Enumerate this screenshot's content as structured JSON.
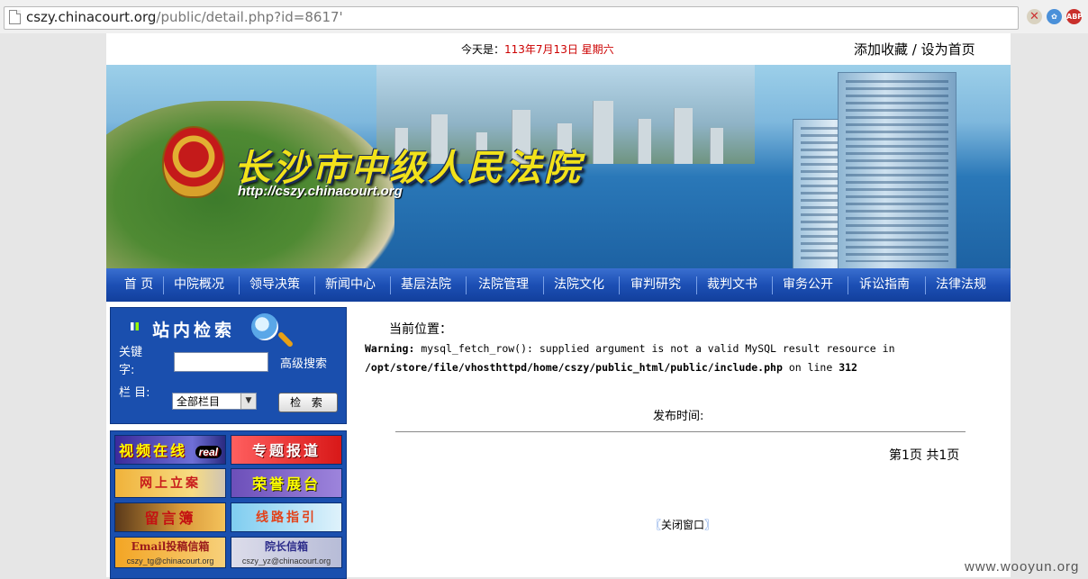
{
  "browser": {
    "url_host": "cszy.chinacourt.org",
    "url_path": "/public/detail.php?id=8617'",
    "extension_icons": [
      "blocker-icon",
      "gear-flower-icon",
      "adblock-icon"
    ],
    "abp_label": "ABP"
  },
  "topbar": {
    "today_label": "今天是：",
    "today_date": "113年7月13日  星期六",
    "favorites": "添加收藏  /  设为首页"
  },
  "banner": {
    "title": "长沙市中级人民法院",
    "url": "http://cszy.chinacourt.org"
  },
  "nav": [
    "首 页",
    "中院概况",
    "领导决策",
    "新闻中心",
    "基层法院",
    "法院管理",
    "法院文化",
    "审判研究",
    "裁判文书",
    "审务公开",
    "诉讼指南",
    "法律法规"
  ],
  "search": {
    "title": "站内检索",
    "keyword_label": "关键字:",
    "advanced": "高级搜索",
    "column_label": "栏  目:",
    "column_value": "全部栏目",
    "button": "检 索"
  },
  "tiles": {
    "video": "视频在线",
    "video_badge": "real",
    "special": "专题报道",
    "online_filing": "网上立案",
    "honor": "荣誉展台",
    "guestbook": "留言簿",
    "route": "线路指引",
    "email_title": "Email投稿信箱",
    "email_addr": "cszy_tg@chinacourt.org",
    "president_title": "院长信箱",
    "president_addr": "cszy_yz@chinacourt.org"
  },
  "content": {
    "breadcrumb": "当前位置：",
    "warning_label": "Warning:",
    "warning_text": " mysql_fetch_row(): supplied argument is not a valid MySQL result resource in",
    "warning_path": "/opt/store/file/vhosthttpd/home/cszy/public_html/public/include.php",
    "warning_line_text": " on line ",
    "warning_line": "312",
    "publish_time": "发布时间:",
    "pager": "第1页  共1页",
    "close_left": "〖",
    "close_label": "关闭窗口",
    "close_right": "〗"
  },
  "watermark": "www.wooyun.org"
}
